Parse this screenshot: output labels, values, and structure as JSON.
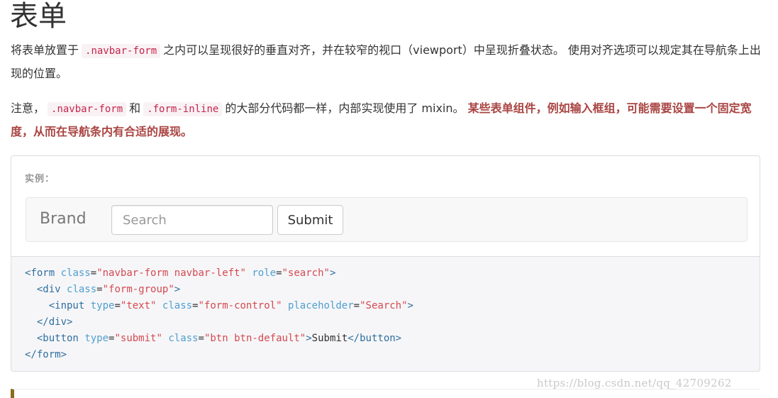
{
  "page": {
    "title": "表单"
  },
  "intro": {
    "part1": "将表单放置于",
    "code1": ".navbar-form",
    "part2": "之内可以呈现很好的垂直对齐，并在较窄的视口（viewport）中呈现折叠状态。 使用对齐选项可以规定其在导航条上出现的位置。"
  },
  "note": {
    "part1": "注意，",
    "code1": ".navbar-form",
    "part2": "和",
    "code2": ".form-inline",
    "part3": "的大部分代码都一样，内部实现使用了 mixin。",
    "warning": "某些表单组件，例如输入框组，可能需要设置一个固定宽度，从而在导航条内有合适的展现。"
  },
  "example": {
    "label": "实例：",
    "navbar": {
      "brand": "Brand",
      "search_placeholder": "Search",
      "submit_label": "Submit"
    }
  },
  "code": {
    "l1_open": "<form",
    "l1_attr1": "class",
    "l1_val1": "\"navbar-form navbar-left\"",
    "l1_attr2": "role",
    "l1_val2": "\"search\"",
    "l1_close": ">",
    "l2_open": "<div",
    "l2_attr1": "class",
    "l2_val1": "\"form-group\"",
    "l2_close": ">",
    "l3_open": "<input",
    "l3_attr1": "type",
    "l3_val1": "\"text\"",
    "l3_attr2": "class",
    "l3_val2": "\"form-control\"",
    "l3_attr3": "placeholder",
    "l3_val3": "\"Search\"",
    "l3_close": ">",
    "l4_tag": "</div>",
    "l5_open": "<button",
    "l5_attr1": "type",
    "l5_val1": "\"submit\"",
    "l5_attr2": "class",
    "l5_val2": "\"btn btn-default\"",
    "l5_close": ">",
    "l5_text": "Submit",
    "l5_end": "</button>",
    "l6_tag": "</form>"
  },
  "watermark": "https://blog.csdn.net/qq_42709262",
  "colors": {
    "inline_code_text": "#c7254e",
    "inline_code_bg": "#f9f2f4",
    "warning": "#a94442",
    "navbar_bg": "#f8f8f8",
    "code_bg": "#f6f6f8"
  }
}
